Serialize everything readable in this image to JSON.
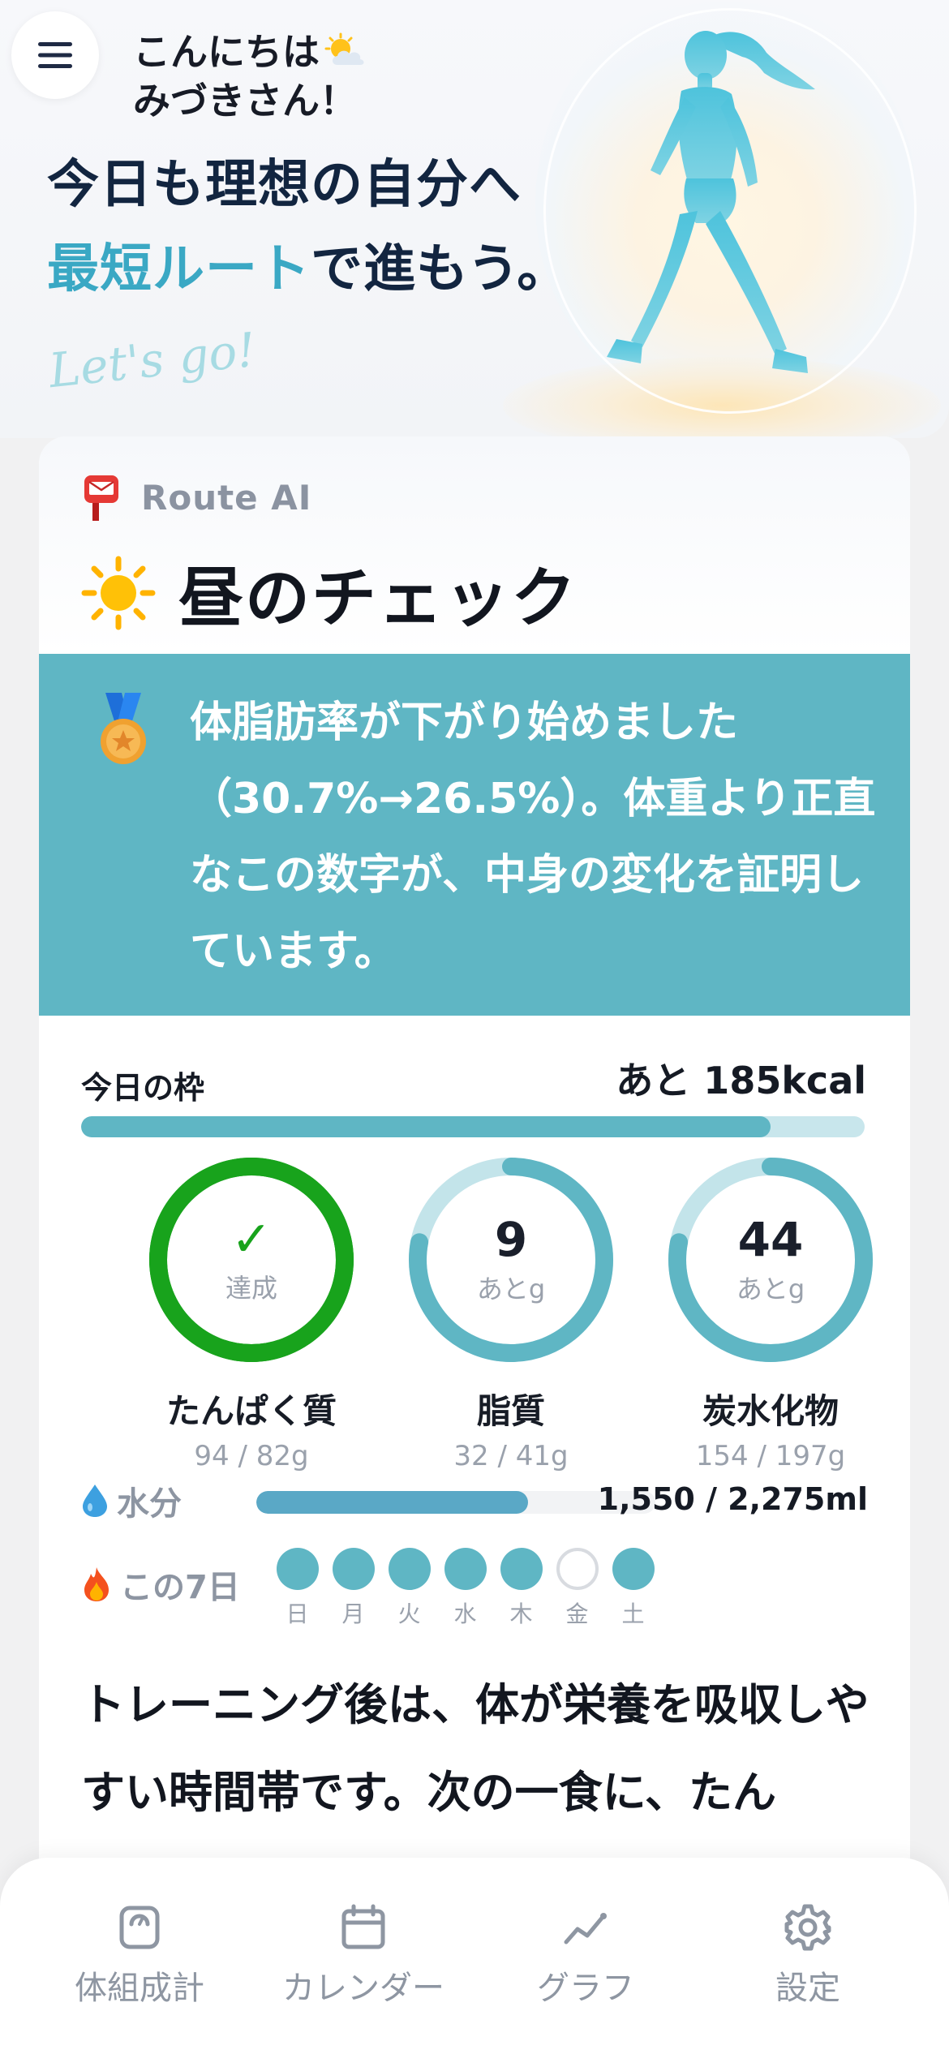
{
  "header": {
    "greeting_line1": "こんにちは",
    "greeting_line2": "みづきさん！",
    "headline_line1": "今日も理想の自分へ",
    "headline_accent": "最短ルート",
    "headline_rest": "で進もう。",
    "tagline": "Let's go!",
    "menu_icon": "hamburger-menu-icon",
    "weather_icon": "sun-behind-cloud-icon"
  },
  "card": {
    "source_label": "Route AI",
    "source_icon": "postbox-icon",
    "check_title": "昼のチェック",
    "check_icon": "sun-icon",
    "banner_icon": "medal-icon",
    "banner_text": "体脂肪率が下がり始めました（30.7%→26.5%）。体重より正直なこの数字が、中身の変化を証明しています。"
  },
  "budget": {
    "label": "今日の枠",
    "remaining": "あと 185kcal",
    "progress": 0.88
  },
  "macros": [
    {
      "name": "たんぱく質",
      "amount": "94 / 82g",
      "center": "✓",
      "sub": "達成",
      "progress": 1.0,
      "achieved": true
    },
    {
      "name": "脂質",
      "amount": "32 / 41g",
      "center": "9",
      "sub": "あとg",
      "progress": 0.78,
      "achieved": false
    },
    {
      "name": "炭水化物",
      "amount": "154 / 197g",
      "center": "44",
      "sub": "あとg",
      "progress": 0.78,
      "achieved": false
    }
  ],
  "water": {
    "icon": "droplet-icon",
    "label": "水分",
    "value": "1,550 / 2,275ml",
    "progress": 0.68
  },
  "week": {
    "icon": "fire-icon",
    "label": "この7日",
    "days": [
      {
        "name": "日",
        "done": true
      },
      {
        "name": "月",
        "done": true
      },
      {
        "name": "火",
        "done": true
      },
      {
        "name": "水",
        "done": true
      },
      {
        "name": "木",
        "done": true
      },
      {
        "name": "金",
        "done": false
      },
      {
        "name": "土",
        "done": true
      }
    ]
  },
  "advice": "トレーニング後は、体が栄養を吸収しやすい時間帯です。次の一食に、たん",
  "nav": [
    {
      "label": "体組成計",
      "icon": "scale-icon"
    },
    {
      "label": "カレンダー",
      "icon": "calendar-icon"
    },
    {
      "label": "グラフ",
      "icon": "chart-line-icon"
    },
    {
      "label": "設定",
      "icon": "gear-icon"
    }
  ],
  "colors": {
    "accent": "#5fb6c4",
    "headline_accent": "#3aa8c4",
    "achieved_green": "#18a31c",
    "water": "#5aa8c6",
    "headline": "#122540"
  }
}
